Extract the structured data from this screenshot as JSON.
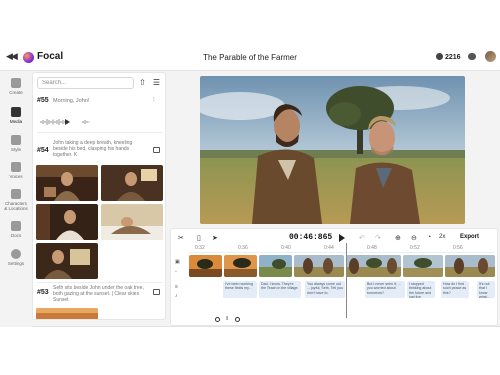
{
  "app": {
    "name": "Focal",
    "project_title": "The Parable of the Farmer",
    "credits": "2216"
  },
  "icons": {
    "collapse": "double-chevron-left-icon",
    "chat": "chat-bubble-icon",
    "upload": "upload-icon",
    "filter": "filter-icon"
  },
  "rail": [
    {
      "label": "Create",
      "icon": "lightbulb-icon"
    },
    {
      "label": "Media",
      "icon": "image-icon"
    },
    {
      "label": "Style",
      "icon": "palette-icon"
    },
    {
      "label": "Voices",
      "icon": "microphone-icon"
    },
    {
      "label": "Characters & Locations",
      "icon": "puzzle-icon"
    },
    {
      "label": "Docs",
      "icon": "document-icon"
    },
    {
      "label": "Settings",
      "icon": "gear-icon"
    }
  ],
  "media_panel": {
    "search_placeholder": "Search...",
    "items": [
      {
        "number": "#55",
        "text": "Morning, John!"
      },
      {
        "number": "#54",
        "text": "John taking a deep breath, kneeling beside his bed, clasping his hands together. K"
      },
      {
        "number": "#53",
        "text": "Seth sits beside John under the oak tree, both gazing at the sunset. | Clear skies Sunset"
      }
    ]
  },
  "timeline": {
    "timecode": "00:46:865",
    "zoom": "2x",
    "export_label": "Export",
    "ruler": [
      "0:32",
      "0:36",
      "0:40",
      "0:44",
      "0:48",
      "0:52",
      "0:56"
    ],
    "captions": [
      "I've been working these fields my...",
      "Dad, I know. They're the Teach in the village.",
      "You always come out ... joyful, Seth. Tell you don't have to.",
      "But I never seen it; ... you worried about tomorrow?",
      "I stopped thinking about the future and just live",
      "How do I find such peace as this?",
      "It's not that I know what..."
    ]
  },
  "colors": {
    "accent": "#222222",
    "caption_bg": "#e4ecf7",
    "rail_bg": "#f3f3f3"
  }
}
